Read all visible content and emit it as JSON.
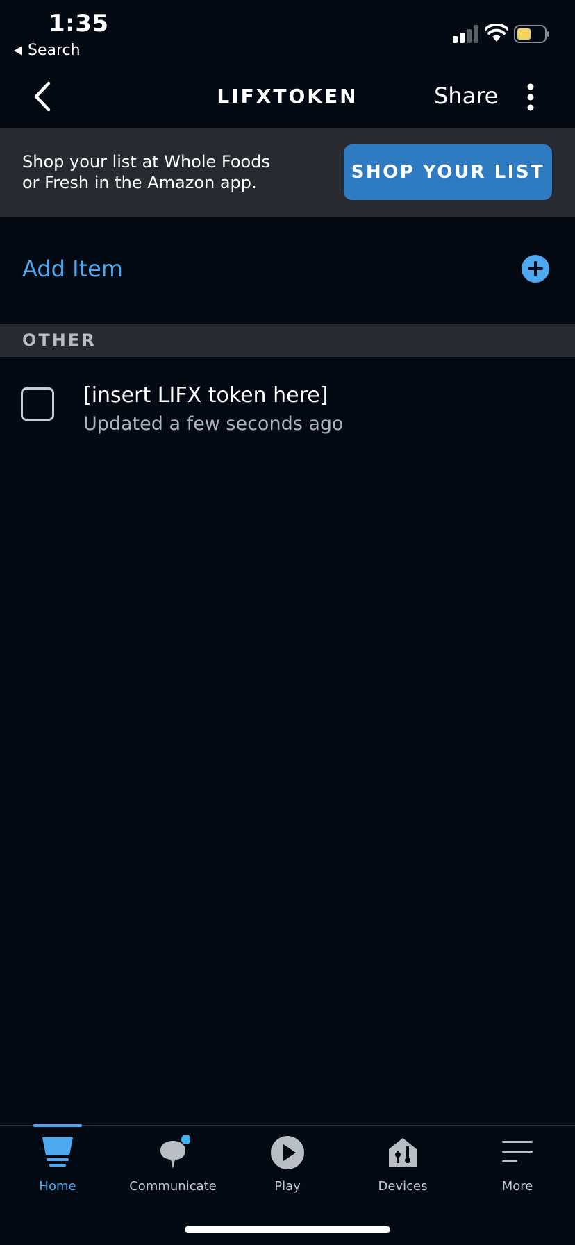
{
  "status_bar": {
    "time": "1:35",
    "back_label": "Search"
  },
  "header": {
    "title": "LIFXTOKEN",
    "share_label": "Share"
  },
  "banner": {
    "text_line1": "Shop your list at Whole Foods",
    "text_line2": "or Fresh in the Amazon app.",
    "button_label": "SHOP YOUR LIST"
  },
  "add_item": {
    "label": "Add Item"
  },
  "sections": [
    {
      "title": "OTHER",
      "items": [
        {
          "text": "[insert LIFX token here]",
          "subtext": "Updated a few seconds ago",
          "checked": false
        }
      ]
    }
  ],
  "tabs": [
    {
      "label": "Home",
      "icon": "home-icon",
      "active": true
    },
    {
      "label": "Communicate",
      "icon": "chat-bubble-icon",
      "active": false,
      "badge": true
    },
    {
      "label": "Play",
      "icon": "play-icon",
      "active": false
    },
    {
      "label": "Devices",
      "icon": "devices-icon",
      "active": false
    },
    {
      "label": "More",
      "icon": "menu-icon",
      "active": false
    }
  ],
  "colors": {
    "background": "#040a13",
    "panel": "#272b31",
    "accent": "#4ea8f0",
    "button": "#2f7bc2",
    "battery": "#f3d55c"
  }
}
